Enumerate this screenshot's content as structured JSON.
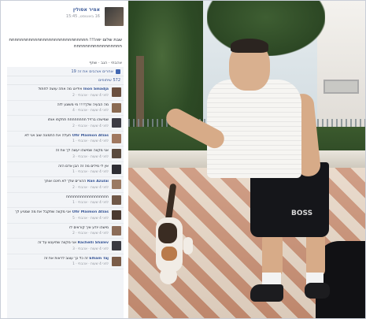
{
  "post": {
    "poster_name": "אמיר אסולין",
    "timestamp": "16 באוגוסט, 15:45",
    "text": "שבת שלום יפה!!! חחחחחחחחחחחחחחחחחחחחחחחחחחחחחחחחחחחחחחחחחחחחח",
    "actions": "אהבתי · הגב · שתף"
  },
  "likes_line": "אחרים אוהבים את זה 19",
  "shares_line": "572 שיתופים",
  "comments": [
    {
      "author": "Inon Smadja",
      "text": "אידיוט מה אתה עושה לחתול",
      "meta": "לפני 4 שעות · אהבתי · 2"
    },
    {
      "author": "",
      "text": "מה הבעיה שלך!!!! מי משוגע לזה",
      "meta": "לפני 4 שעות · אהבתי · 4"
    },
    {
      "author": "",
      "text": "שמישהו ברזיל חחחחחחחח תתקפו אותו",
      "meta": "לפני 4 שעות · אהבתי · 2"
    },
    {
      "author": "Ofir Maimon Atias",
      "text": "תעלה את התמונה שוב אני לא",
      "meta": "לפני 4 שעות · אהבתי · 1"
    },
    {
      "author": "",
      "text": "אני מקווה שמישהו יעשה לך את זה",
      "meta": "לפני 4 שעות · אהבתי · 3"
    },
    {
      "author": "",
      "text": "אין לי מילים מה זה הבן אדם הזה",
      "meta": "לפני 4 שעות · אהבתי · 1"
    },
    {
      "author": "Ran Azulai",
      "text": "ההורים שלך לא חינכו אותך",
      "meta": "לפני 4 שעות · אהבתי · 2"
    },
    {
      "author": "",
      "text": "חחחחחחחחחחחחחחחחחח",
      "meta": "לפני 4 שעות · אהבתי · 1"
    },
    {
      "author": "Ofir Maimon Atias",
      "text": "אני מקווה שתקבל את מה שמגיע לך",
      "meta": "לפני 4 שעות · אהבתי · 5"
    },
    {
      "author": "",
      "text": "מישהו יודע איך קוראים לו",
      "meta": "לפני 4 שעות · אהבתי · 2"
    },
    {
      "author": "Rachelli Shalev",
      "text": "אני מקווה שתיענש על זה",
      "meta": "לפני 4 שעות · אהבתי · 3"
    },
    {
      "author": "Elham Taj",
      "text": "זה כל כך עצוב לראות את זה",
      "meta": "לפני 4 שעות · אהבתי · 1"
    }
  ],
  "photo": {
    "shorts_text": "BOSS"
  },
  "colors": {
    "link_blue": "#3b5998",
    "like_blue": "#4267b2",
    "comments_bg": "#f2f4f7"
  },
  "icons": [
    "like-thumb-icon",
    "share-icon"
  ]
}
